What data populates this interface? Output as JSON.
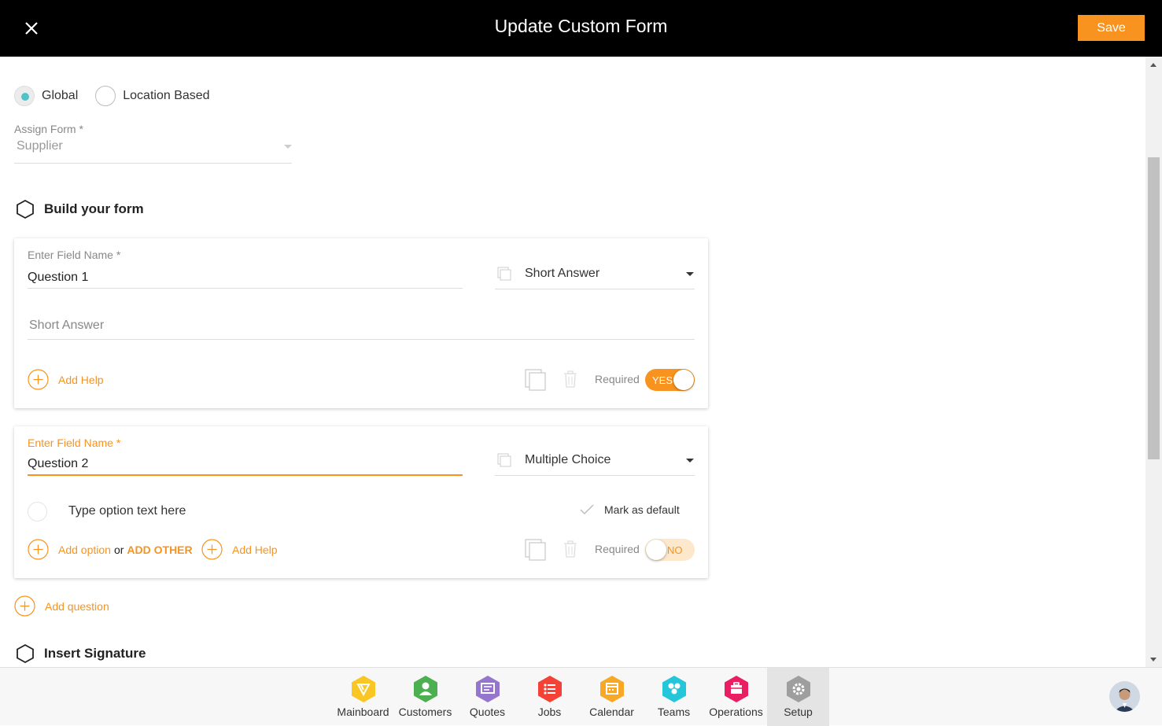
{
  "header": {
    "title": "Update Custom Form",
    "save_label": "Save"
  },
  "scope": {
    "options": [
      {
        "label": "Global",
        "selected": true
      },
      {
        "label": "Location Based",
        "selected": false
      }
    ]
  },
  "assign_form": {
    "label": "Assign Form",
    "required_mark": "*",
    "value": "Supplier"
  },
  "sections": {
    "build": "Build your form",
    "signature": "Insert Signature"
  },
  "questions": [
    {
      "field_label": "Enter Field Name",
      "required_mark": "*",
      "field_value": "Question 1",
      "type": "Short Answer",
      "answer_placeholder": "Short Answer",
      "add_help": "Add Help",
      "required_label": "Required",
      "required_state": "YES"
    },
    {
      "field_label": "Enter Field Name",
      "required_mark": "*",
      "field_value": "Question 2",
      "type": "Multiple Choice",
      "option_placeholder": "Type option text here",
      "mark_default": "Mark as default",
      "add_option": "Add option",
      "or": "or",
      "add_other": "ADD OTHER",
      "add_help": "Add Help",
      "required_label": "Required",
      "required_state": "NO"
    }
  ],
  "add_question": "Add question",
  "bottom_nav": [
    {
      "label": "Mainboard",
      "icon": "mainboard-icon",
      "color": "#f9c623"
    },
    {
      "label": "Customers",
      "icon": "customers-icon",
      "color": "#4caf50"
    },
    {
      "label": "Quotes",
      "icon": "quotes-icon",
      "color": "#9575cd"
    },
    {
      "label": "Jobs",
      "icon": "jobs-icon",
      "color": "#f44336"
    },
    {
      "label": "Calendar",
      "icon": "calendar-icon",
      "color": "#f9a825"
    },
    {
      "label": "Teams",
      "icon": "teams-icon",
      "color": "#26c6da"
    },
    {
      "label": "Operations",
      "icon": "operations-icon",
      "color": "#e91e63"
    },
    {
      "label": "Setup",
      "icon": "setup-icon",
      "color": "#9e9e9e",
      "active": true
    }
  ],
  "colors": {
    "accent": "#f7931e",
    "radio_selected": "#4fc3c8",
    "header_bg": "#000000"
  }
}
